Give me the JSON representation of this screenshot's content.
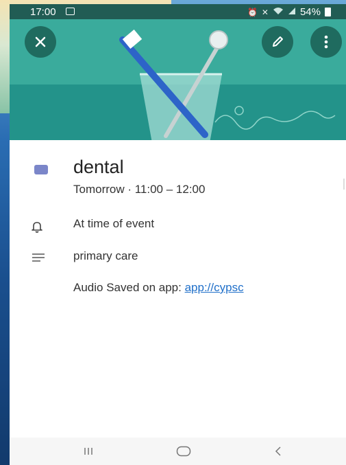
{
  "status_bar": {
    "time": "17:00",
    "battery_percent": "54%",
    "icons": [
      "gallery-icon",
      "alarm-icon",
      "mute-icon",
      "wifi-icon",
      "signal-icon",
      "battery-icon"
    ]
  },
  "header": {
    "close_icon": "close-icon",
    "edit_icon": "pencil-icon",
    "more_icon": "more-vert-icon",
    "illustration": "toothbrush-in-glass",
    "background_color": "#2ea293"
  },
  "event": {
    "title": "dental",
    "color": "#7b86c9",
    "when": "Tomorrow  ·  11:00 – 12:00",
    "reminder": "At time of event",
    "description": "primary care",
    "audio_prefix": "Audio Saved on app: ",
    "audio_link": "app://cypsc"
  },
  "nav_bar": {
    "recents_icon": "recents-icon",
    "home_icon": "home-icon",
    "back_icon": "back-icon"
  }
}
